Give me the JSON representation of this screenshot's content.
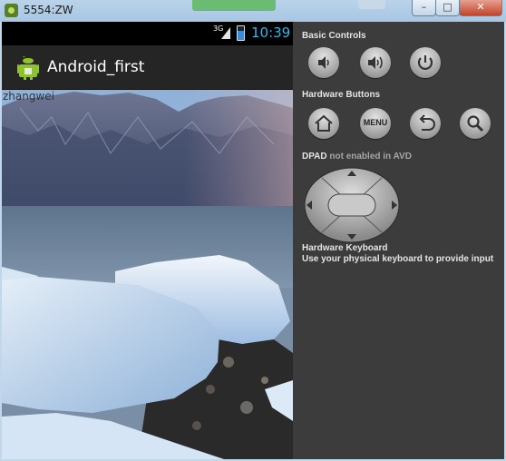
{
  "window": {
    "title": "5554:ZW",
    "min_label": "–",
    "max_label": "□",
    "close_label": "✕"
  },
  "statusbar": {
    "network": "3G",
    "time": "10:39"
  },
  "app": {
    "title": "Android_first",
    "label": "zhangwei"
  },
  "panel": {
    "basic_controls": "Basic Controls",
    "hardware_buttons": "Hardware Buttons",
    "dpad": "DPAD",
    "dpad_note": "not enabled in AVD",
    "keyboard_title": "Hardware Keyboard",
    "keyboard_note": "Use your physical keyboard to provide input",
    "menu_label": "MENU",
    "buttons": {
      "volume_down": "volume-down-icon",
      "volume_up": "volume-up-icon",
      "power": "power-icon",
      "home": "home-icon",
      "back": "back-icon",
      "search": "search-icon"
    }
  },
  "colors": {
    "panel_bg": "#3c3c3c",
    "clock": "#35b5e5",
    "actionbar_bg": "#252525"
  }
}
